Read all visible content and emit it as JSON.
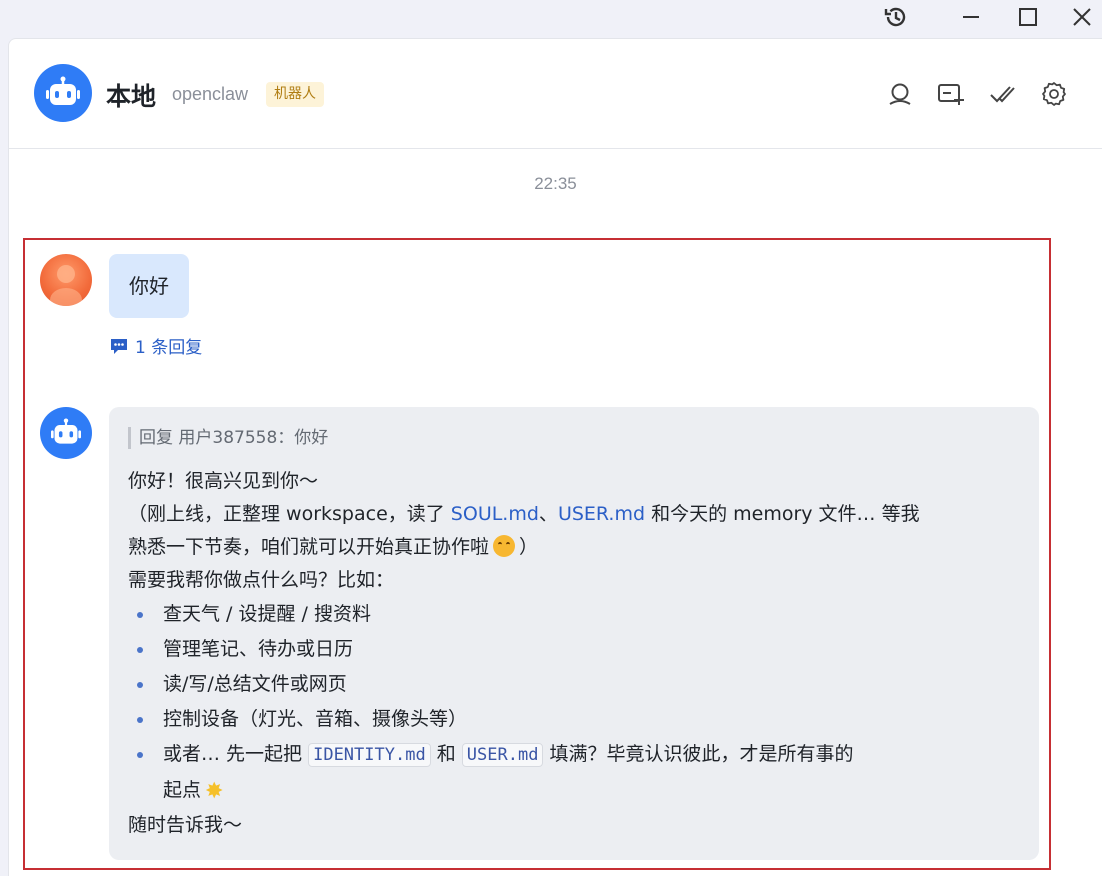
{
  "header": {
    "title": "本地",
    "subtitle": "openclaw",
    "badge": "机器人"
  },
  "chat": {
    "timestamp": "22:35",
    "user_message": "你好",
    "reply_count": "1 条回复",
    "bot": {
      "quote": "回复 用户387558：你好",
      "line1": "你好！很高兴见到你～",
      "line2_pre": "（刚上线，正整理 workspace，读了 ",
      "link_soul": "SOUL.md",
      "sep": "、",
      "link_user": "USER.md",
      "line2_post": " 和今天的 memory 文件… 等我",
      "line3_pre": "熟悉一下节奏，咱们就可以开始真正协作啦",
      "line3_post": "）",
      "line4": "需要我帮你做点什么吗？比如：",
      "items": [
        "查天气 / 设提醒 / 搜资料",
        "管理笔记、待办或日历",
        "读/写/总结文件或网页",
        "控制设备（灯光、音箱、摄像头等）"
      ],
      "last_item_pre": "或者… 先一起把 ",
      "code_identity": "IDENTITY.md",
      "last_item_and": " 和 ",
      "code_user": "USER.md",
      "last_item_post": " 填满？毕竟认识彼此，才是所有事的",
      "last_item_wrap": "起点",
      "closing": "随时告诉我～",
      "emojis": [
        "smiling-face",
        "glowing-star"
      ]
    }
  },
  "colors": {
    "accent": "#2f7cf6",
    "user_bubble": "#d9e8fd",
    "bot_bubble": "#eceef2",
    "link": "#2b5fc7",
    "highlight_border": "#c62f34"
  }
}
